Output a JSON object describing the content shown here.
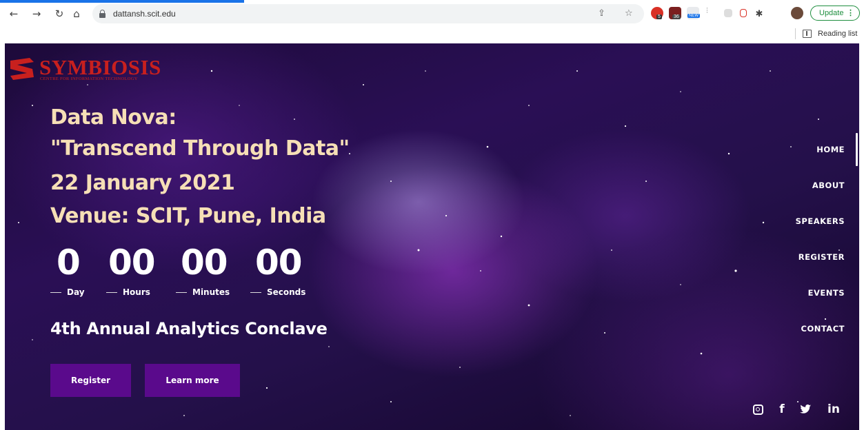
{
  "browser": {
    "url": "dattansh.scit.edu",
    "update_label": "Update",
    "update_menu": "⋮",
    "reading_list_label": "Reading list",
    "extension_badges": [
      "5",
      "36",
      "NEW"
    ]
  },
  "site": {
    "logo_text": "SYMBIOSIS",
    "logo_subtitle": "CENTRE FOR INFORMATION TECHNOLOGY",
    "headline": [
      "Data Nova:",
      "\"Transcend Through Data\"",
      "22 January 2021",
      "Venue: SCIT, Pune, India"
    ],
    "countdown": {
      "days": "0",
      "hours": "00",
      "minutes": "00",
      "seconds": "00",
      "days_label": "Day",
      "hours_label": "Hours",
      "minutes_label": "Minutes",
      "seconds_label": "Seconds"
    },
    "subtitle": "4th Annual Analytics Conclave",
    "buttons": {
      "register": "Register",
      "learn_more": "Learn more"
    },
    "menu": [
      "HOME",
      "ABOUT",
      "SPEAKERS",
      "REGISTER",
      "EVENTS",
      "CONTACT"
    ],
    "social": {
      "facebook": "f",
      "linkedin": "in"
    }
  },
  "colors": {
    "headline": "#f6dfb6",
    "button": "#5a0a8c",
    "brand": "#c8201e"
  },
  "icons": [
    "back-icon",
    "forward-icon",
    "reload-icon",
    "home-icon",
    "lock-icon",
    "share-icon",
    "star-icon",
    "puzzle-icon",
    "profile-avatar",
    "reading-list-icon",
    "instagram-icon",
    "facebook-icon",
    "twitter-icon",
    "linkedin-icon"
  ]
}
